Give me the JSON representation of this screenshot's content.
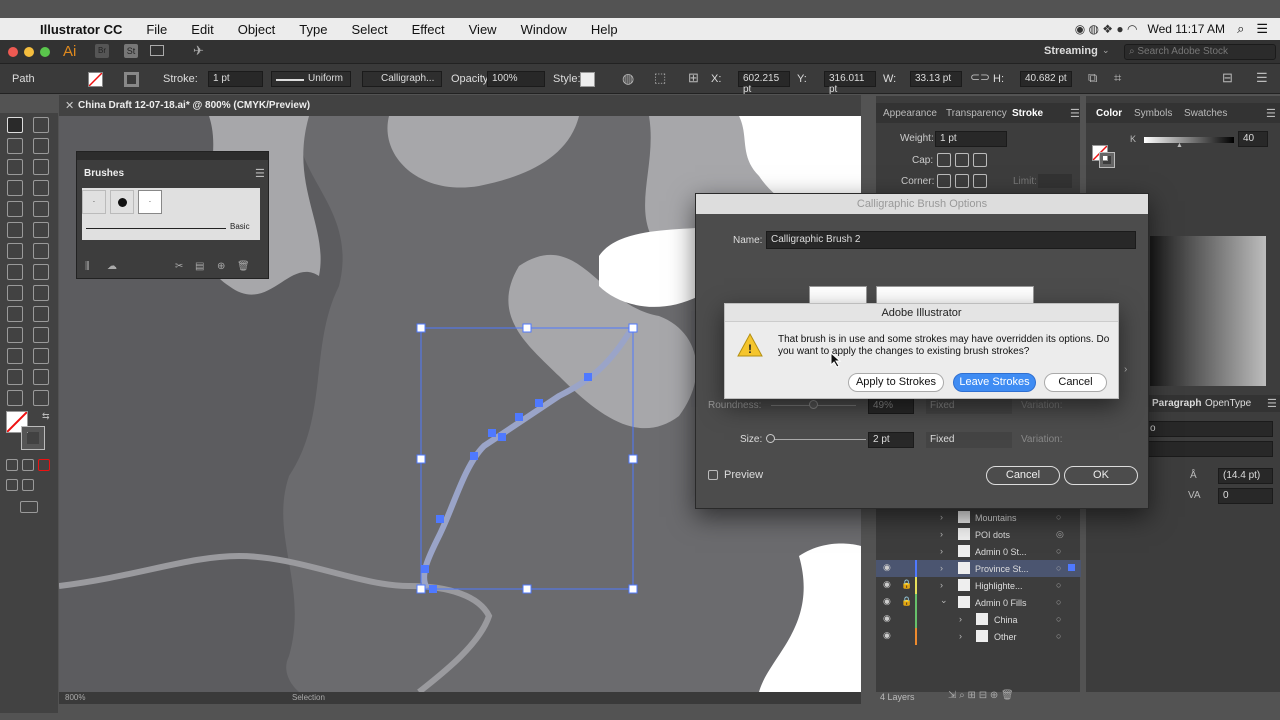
{
  "menubar": {
    "app": "Illustrator CC",
    "items": [
      "File",
      "Edit",
      "Object",
      "Type",
      "Select",
      "Effect",
      "View",
      "Window",
      "Help"
    ],
    "clock": "Wed 11:17 AM"
  },
  "appbar": {
    "workspace": "Streaming",
    "search_placeholder": "Search Adobe Stock",
    "ai_label": "Ai",
    "br_label": "Br",
    "st_label": "St"
  },
  "control": {
    "object": "Path",
    "stroke_label": "Stroke:",
    "stroke_value": "1 pt",
    "profile": "Uniform",
    "brush": "Calligraph...",
    "opacity_label": "Opacity:",
    "opacity_value": "100%",
    "style_label": "Style:",
    "x_label": "X:",
    "x_value": "602.215 pt",
    "y_label": "Y:",
    "y_value": "316.011 pt",
    "w_label": "W:",
    "w_value": "33.13 pt",
    "h_label": "H:",
    "h_value": "40.682 pt"
  },
  "document_tab": "China Draft 12-07-18.ai* @ 800% (CMYK/Preview)",
  "brushes": {
    "title": "Brushes",
    "basic": "Basic"
  },
  "stroke_panel": {
    "tabs": [
      "Appearance",
      "Transparency",
      "Stroke"
    ],
    "weight_label": "Weight:",
    "weight_value": "1 pt",
    "cap_label": "Cap:",
    "corner_label": "Corner:",
    "limit_label": "Limit:"
  },
  "color_panel": {
    "tabs": [
      "Color",
      "Symbols",
      "Swatches"
    ],
    "k_label": "K",
    "k_value": "40"
  },
  "type_panel": {
    "tabs": [
      "Paragraph",
      "OpenType"
    ],
    "leading": "(14.4 pt)",
    "tracking": "0"
  },
  "brush_dialog": {
    "title": "Calligraphic Brush Options",
    "name_label": "Name:",
    "name_value": "Calligraphic Brush 2",
    "roundness_label": "Roundness:",
    "roundness_value": "49%",
    "roundness_mode": "Fixed",
    "variation_label": "Variation:",
    "size_label": "Size:",
    "size_value": "2 pt",
    "size_mode": "Fixed",
    "preview": "Preview",
    "cancel": "Cancel",
    "ok": "OK"
  },
  "alert": {
    "title": "Adobe Illustrator",
    "message": "That brush is in use and some strokes may have overridden its options.  Do you want to apply the changes to existing brush strokes?",
    "apply": "Apply to Strokes",
    "leave": "Leave Strokes",
    "cancel": "Cancel"
  },
  "layers": {
    "rows": [
      "Mountains",
      "POI dots",
      "Admin 0 St...",
      "Province St...",
      "Highlighte...",
      "Admin 0 Fills",
      "China",
      "Other"
    ],
    "count": "4 Layers"
  },
  "status": {
    "zoom": "800%",
    "tool": "Selection"
  }
}
